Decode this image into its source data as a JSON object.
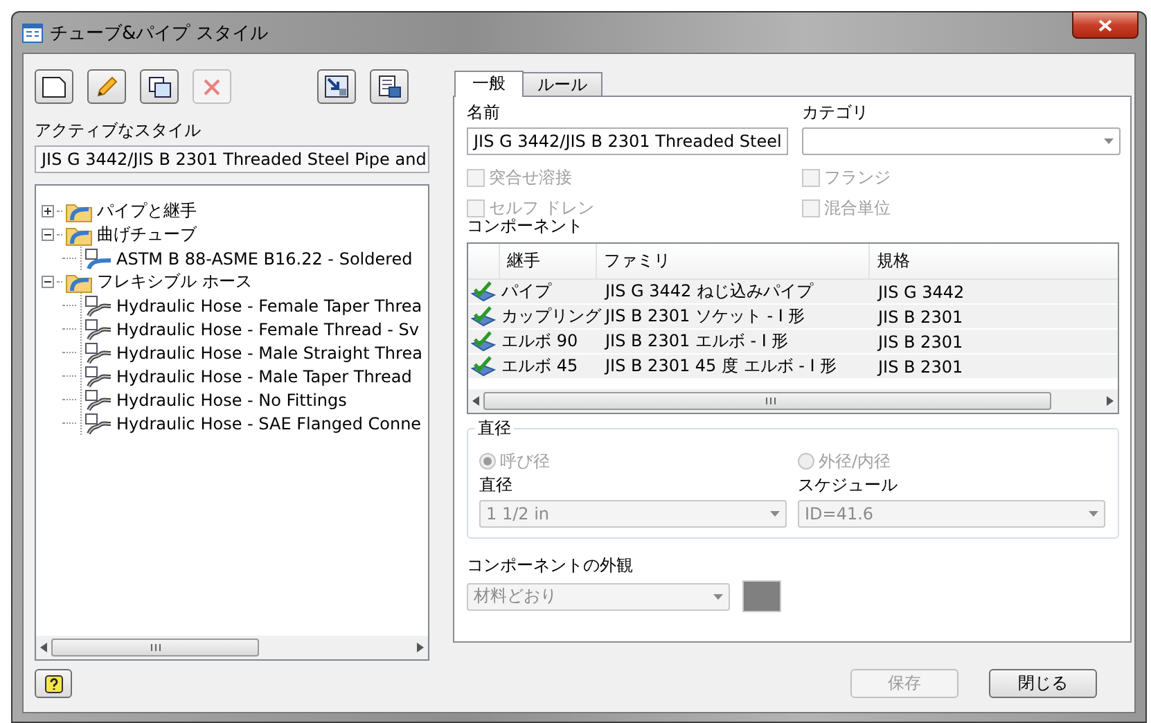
{
  "window": {
    "title": "チューブ&パイプ スタイル"
  },
  "toolbar": [
    {
      "kind": "new",
      "disabled": false
    },
    {
      "kind": "edit",
      "disabled": false
    },
    {
      "kind": "copy",
      "disabled": false
    },
    {
      "kind": "delete",
      "disabled": true
    },
    {
      "kind": "import",
      "disabled": false
    },
    {
      "kind": "export",
      "disabled": false
    }
  ],
  "active_style": {
    "label": "アクティブなスタイル",
    "value": "JIS G 3442/JIS B 2301 Threaded Steel Pipe and"
  },
  "tree": [
    {
      "label": "パイプと継手",
      "kind": "folder",
      "expanded": false
    },
    {
      "label": "曲げチューブ",
      "kind": "folder",
      "expanded": true,
      "children": [
        {
          "label": "ASTM B 88-ASME B16.22 - Soldered",
          "kind": "tube"
        }
      ]
    },
    {
      "label": "フレキシブル ホース",
      "kind": "folder",
      "expanded": true,
      "children": [
        {
          "label": "Hydraulic Hose - Female Taper Threa",
          "kind": "hose"
        },
        {
          "label": "Hydraulic Hose - Female Thread - Sv",
          "kind": "hose"
        },
        {
          "label": "Hydraulic Hose - Male Straight Threa",
          "kind": "hose"
        },
        {
          "label": "Hydraulic Hose - Male Taper Thread",
          "kind": "hose"
        },
        {
          "label": "Hydraulic Hose - No Fittings",
          "kind": "hose"
        },
        {
          "label": "Hydraulic Hose - SAE Flanged Conne",
          "kind": "hose"
        }
      ]
    }
  ],
  "tabs": [
    {
      "label": "一般",
      "selected": true
    },
    {
      "label": "ルール",
      "selected": false
    }
  ],
  "name": {
    "label": "名前",
    "value": "JIS G 3442/JIS B 2301 Threaded Steel"
  },
  "category": {
    "label": "カテゴリ"
  },
  "checkboxes": [
    {
      "label": "突合せ溶接",
      "checked": false,
      "disabled": true
    },
    {
      "label": "フランジ",
      "checked": false,
      "disabled": true
    },
    {
      "label": "セルフ ドレン",
      "checked": false,
      "disabled": true
    },
    {
      "label": "混合単位",
      "checked": false,
      "disabled": true
    }
  ],
  "components": {
    "label": "コンポーネント",
    "columns": [
      "継手",
      "ファミリ",
      "規格"
    ],
    "rows": [
      {
        "checked": true,
        "cells": [
          "パイプ",
          "JIS G 3442 ねじ込みパイプ",
          "JIS G 3442"
        ]
      },
      {
        "checked": true,
        "cells": [
          "カップリング",
          "JIS B 2301 ソケット - I 形",
          "JIS B 2301"
        ]
      },
      {
        "checked": true,
        "cells": [
          "エルボ 90",
          "JIS B 2301 エルボ - I 形",
          "JIS B 2301"
        ]
      },
      {
        "checked": true,
        "cells": [
          "エルボ 45",
          "JIS B 2301 45 度 エルボ - I 形",
          "JIS B 2301"
        ]
      }
    ]
  },
  "diameter": {
    "title": "直径",
    "radios": [
      {
        "label": "呼び径",
        "selected": true,
        "disabled": true
      },
      {
        "label": "外径/内径",
        "selected": false,
        "disabled": true
      }
    ],
    "size": {
      "label": "直径",
      "value": "1 1/2 in",
      "disabled": true
    },
    "schedule": {
      "label": "スケジュール",
      "value": "ID=41.6",
      "disabled": true
    }
  },
  "appearance": {
    "label": "コンポーネントの外観",
    "value": "材料どおり",
    "disabled": true,
    "color": "#808080"
  },
  "buttons": [
    {
      "kind": "help",
      "disabled": false
    },
    {
      "kind": "text",
      "label": "保存",
      "disabled": true
    },
    {
      "kind": "text",
      "label": "閉じる",
      "disabled": false
    }
  ]
}
